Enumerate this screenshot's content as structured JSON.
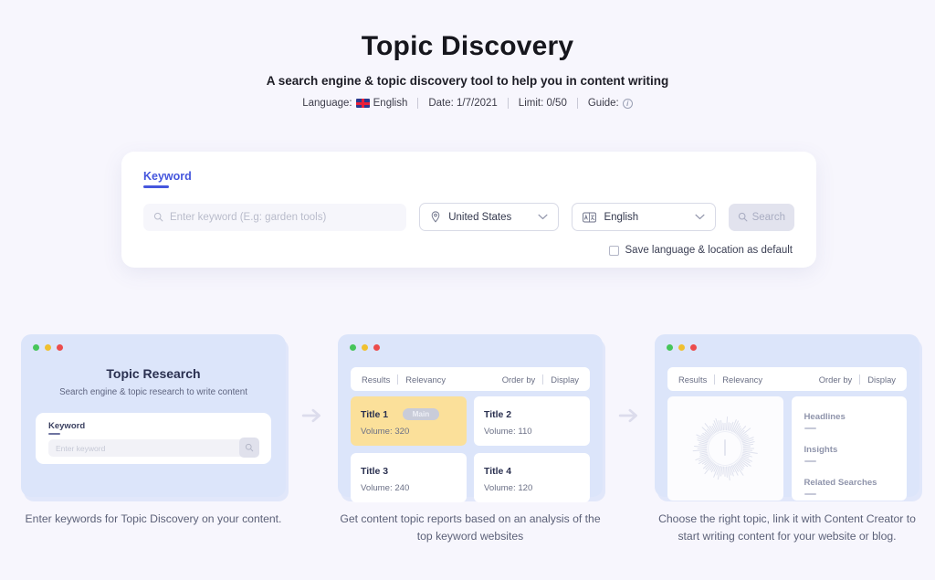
{
  "header": {
    "title": "Topic Discovery",
    "subtitle": "A search engine & topic discovery tool to help you in content writing",
    "meta": {
      "language_label": "Language:",
      "language_value": "English",
      "date": "Date: 1/7/2021",
      "limit": "Limit: 0/50",
      "guide_label": "Guide:",
      "guide_icon": "info-circle-icon"
    }
  },
  "search_panel": {
    "tab_label": "Keyword",
    "keyword_placeholder": "Enter keyword (E.g: garden tools)",
    "keyword_value": "",
    "country_value": "United States",
    "country_icon": "location-pin-icon",
    "language_value": "English",
    "language_icon": "translate-icon",
    "search_button": "Search",
    "search_icon": "search-icon",
    "chevron_icon": "chevron-down-icon",
    "save_default_label": "Save language & location as default",
    "save_default_checked": false
  },
  "steps": [
    {
      "caption": "Enter keywords for Topic Discovery on your content.",
      "mock": {
        "title": "Topic Research",
        "subtitle": "Search engine & topic research to write content",
        "keyword_label": "Keyword",
        "keyword_placeholder": "Enter keyword",
        "go_icon": "search-icon"
      }
    },
    {
      "caption": "Get content topic reports based on an analysis of the top keyword websites",
      "mock": {
        "toolbar": {
          "results": "Results",
          "relevancy": "Relevancy",
          "order_by": "Order by",
          "display": "Display"
        },
        "tiles": [
          {
            "title": "Title 1",
            "volume": "Volume: 320",
            "badge": "Main",
            "highlight": true
          },
          {
            "title": "Title 2",
            "volume": "Volume: 110",
            "badge": "",
            "highlight": false
          },
          {
            "title": "Title 3",
            "volume": "Volume: 240",
            "badge": "",
            "highlight": false
          },
          {
            "title": "Title 4",
            "volume": "Volume: 120",
            "badge": "",
            "highlight": false
          }
        ]
      }
    },
    {
      "caption": "Choose the right topic, link it with Content Creator to start writing content for your website or blog.",
      "mock": {
        "toolbar": {
          "results": "Results",
          "relevancy": "Relevancy",
          "order_by": "Order by",
          "display": "Display"
        },
        "chart_icon": "radial-sunburst-chart",
        "items": [
          "Headlines",
          "Insights",
          "Related Searches"
        ]
      }
    }
  ],
  "arrows": {
    "icon": "arrow-right-icon"
  },
  "colors": {
    "page_background": "#f7f6fd",
    "accent": "#4556dd",
    "mock_card": "#dce5fa",
    "highlight_tile": "#fbe09a",
    "muted_text": "#5c6178"
  }
}
